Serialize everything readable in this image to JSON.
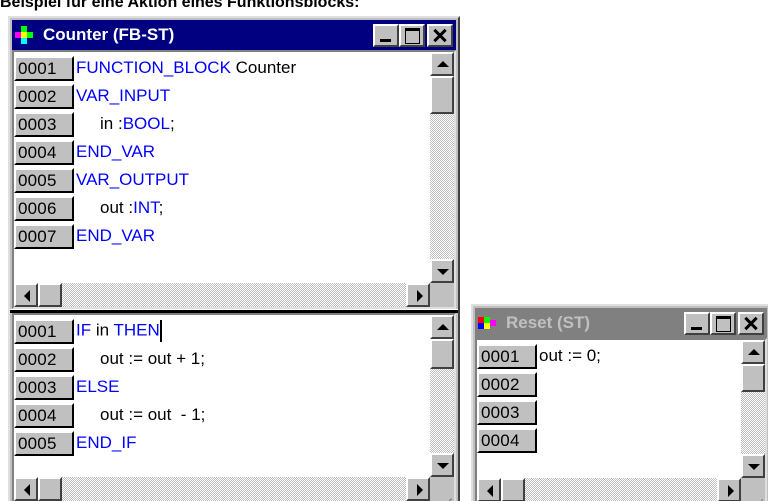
{
  "caption": "Beispiel für eine Aktion eines Funktionsblocks:",
  "counter_window": {
    "title": "Counter (FB-ST)",
    "declaration_lines": [
      {
        "num": "0001",
        "indent": false,
        "parts": [
          {
            "text": "FUNCTION_BLOCK",
            "kw": true
          },
          {
            "text": " Counter",
            "kw": false
          }
        ]
      },
      {
        "num": "0002",
        "indent": false,
        "parts": [
          {
            "text": "VAR_INPUT",
            "kw": true
          }
        ]
      },
      {
        "num": "0003",
        "indent": true,
        "parts": [
          {
            "text": "in :",
            "kw": false
          },
          {
            "text": "BOOL",
            "kw": true
          },
          {
            "text": ";",
            "kw": false
          }
        ]
      },
      {
        "num": "0004",
        "indent": false,
        "parts": [
          {
            "text": "END_VAR",
            "kw": true
          }
        ]
      },
      {
        "num": "0005",
        "indent": false,
        "parts": [
          {
            "text": "VAR_OUTPUT",
            "kw": true
          }
        ]
      },
      {
        "num": "0006",
        "indent": true,
        "parts": [
          {
            "text": "out :",
            "kw": false
          },
          {
            "text": "INT",
            "kw": true
          },
          {
            "text": ";",
            "kw": false
          }
        ]
      },
      {
        "num": "0007",
        "indent": false,
        "parts": [
          {
            "text": "END_VAR",
            "kw": true
          }
        ]
      }
    ],
    "body_lines": [
      {
        "num": "0001",
        "indent": false,
        "caret": true,
        "parts": [
          {
            "text": "IF",
            "kw": true
          },
          {
            "text": " in ",
            "kw": false
          },
          {
            "text": "THEN",
            "kw": true
          }
        ]
      },
      {
        "num": "0002",
        "indent": true,
        "parts": [
          {
            "text": "out := out + 1;",
            "kw": false
          }
        ]
      },
      {
        "num": "0003",
        "indent": false,
        "parts": [
          {
            "text": "ELSE",
            "kw": true
          }
        ]
      },
      {
        "num": "0004",
        "indent": true,
        "parts": [
          {
            "text": "out := out  - 1;",
            "kw": false
          }
        ]
      },
      {
        "num": "0005",
        "indent": false,
        "parts": [
          {
            "text": "END_IF",
            "kw": true
          }
        ]
      }
    ]
  },
  "reset_window": {
    "title": "Reset (ST)",
    "lines": [
      {
        "num": "0001",
        "indent": false,
        "parts": [
          {
            "text": "out := 0;",
            "kw": false
          }
        ]
      },
      {
        "num": "0002",
        "indent": false,
        "parts": []
      },
      {
        "num": "0003",
        "indent": false,
        "parts": []
      },
      {
        "num": "0004",
        "indent": false,
        "parts": []
      }
    ]
  },
  "colors": {
    "keyword": "#0000ff",
    "active_title": "#000080",
    "inactive_title": "#808080",
    "face": "#c0c0c0"
  },
  "icons": [
    "app-icon",
    "minimize-icon",
    "maximize-icon",
    "close-icon",
    "scroll-up-icon",
    "scroll-down-icon",
    "scroll-left-icon",
    "scroll-right-icon",
    "resize-grip-icon"
  ]
}
